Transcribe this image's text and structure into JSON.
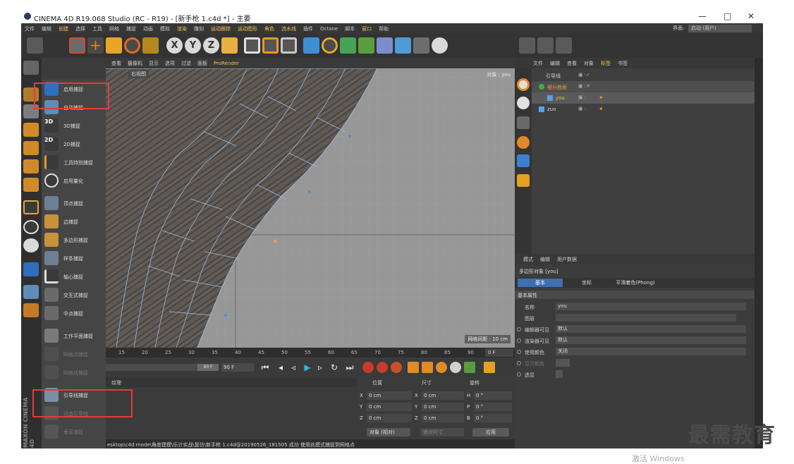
{
  "window": {
    "title": "CINEMA 4D R19.068 Studio (RC - R19) - [新手枪 1.c4d *] - 主要",
    "controls": [
      "—",
      "□",
      "✕"
    ]
  },
  "menu": {
    "items": [
      "文件",
      "编辑",
      "创建",
      "选择",
      "工具",
      "网格",
      "捕捉",
      "动画",
      "模拟",
      "渲染",
      "雕刻",
      "运动跟踪",
      "运动图形",
      "角色",
      "流水线",
      "插件",
      "Octane",
      "脚本",
      "窗口",
      "帮助"
    ],
    "layout_label": "界面:",
    "layout_value": "启动 (用户)"
  },
  "viewport": {
    "menu": [
      "查看",
      "摄像机",
      "显示",
      "选项",
      "过滤",
      "面板"
    ],
    "prorender": "ProRender",
    "view_name": "右视图",
    "object_info": "对象 : you",
    "grid_spacing": "网格间距 : 10 cm"
  },
  "snap_menu": {
    "items": [
      {
        "label": "启用捕捉"
      },
      {
        "label": "自动捕捉"
      },
      {
        "label": "3D捕捉"
      },
      {
        "label": "2D捕捉"
      },
      {
        "label": "工具特别捕捉"
      },
      {
        "label": "启用量化"
      },
      {
        "label": "顶点捕捉"
      },
      {
        "label": "边捕捉"
      },
      {
        "label": "多边形捕捉"
      },
      {
        "label": "样条捕捉"
      },
      {
        "label": "轴心捕捉"
      },
      {
        "label": "交互式捕捉"
      },
      {
        "label": "中点捕捉"
      },
      {
        "label": "工作平面捕捉"
      },
      {
        "label": "网格点捕捉"
      },
      {
        "label": "网格线捕捉"
      },
      {
        "label": "引导线捕捉"
      },
      {
        "label": "动态引导线"
      },
      {
        "label": "垂直捕捉"
      }
    ]
  },
  "timeline": {
    "ticks": [
      "15",
      "20",
      "25",
      "30",
      "35",
      "40",
      "45",
      "50",
      "55",
      "60",
      "65",
      "70",
      "75",
      "80",
      "85",
      "90"
    ],
    "current_frame": "0 F",
    "end_frame": "90 F",
    "end_field": "90 F"
  },
  "materials": {
    "menu": [
      "纹理"
    ]
  },
  "coordinates": {
    "headers": [
      "位置",
      "尺寸",
      "旋转"
    ],
    "rows": [
      {
        "pos_axis": "X",
        "pos": "0 cm",
        "size_axis": "X",
        "size": "0 cm",
        "rot_axis": "H",
        "rot": "0 °"
      },
      {
        "pos_axis": "Y",
        "pos": "0 cm",
        "size_axis": "Y",
        "size": "0 cm",
        "rot_axis": "P",
        "rot": "0 °"
      },
      {
        "pos_axis": "Z",
        "pos": "0 cm",
        "size_axis": "Z",
        "size": "0 cm",
        "rot_axis": "B",
        "rot": "0 °"
      }
    ],
    "mode": "对象 (相对)",
    "size_mode": "绝对尺寸",
    "apply": "应用"
  },
  "status": "esktop\\c4d mode\\角度建模\\乐计实战\\复仿\\新手枪 1.c4d@20190526_181505 成功    使用此模式捕捉到网格点",
  "object_manager": {
    "menu": [
      "文件",
      "编辑",
      "查看",
      "对象",
      "标签",
      "书签"
    ],
    "objects": [
      {
        "name": "引导线"
      },
      {
        "name": "细分曲面"
      },
      {
        "name": "you"
      },
      {
        "name": "zuo"
      }
    ]
  },
  "attributes": {
    "menu": [
      "模式",
      "编辑",
      "用户数据"
    ],
    "object_title": "多边形对象 [you]",
    "tabs": [
      "基本",
      "坐标",
      "平滑着色(Phong)"
    ],
    "section": "基本属性",
    "rows": [
      {
        "label": "名称",
        "value": "you"
      },
      {
        "label": "图层",
        "value": ""
      },
      {
        "label": "编辑器可见",
        "value": "默认"
      },
      {
        "label": "渲染器可见",
        "value": "默认"
      },
      {
        "label": "使用颜色",
        "value": "关闭"
      },
      {
        "label": "显示颜色",
        "value": ""
      },
      {
        "label": "透显",
        "value": ""
      }
    ]
  },
  "overlay": {
    "watermark": "最需教育",
    "activate": "激活 Windows",
    "maxon": "MAXON CINEMA 4D"
  },
  "colors": {
    "highlight_red": "#e33b3b",
    "accent_blue": "#3e6fae",
    "menu_highlight": "#f1c453"
  }
}
